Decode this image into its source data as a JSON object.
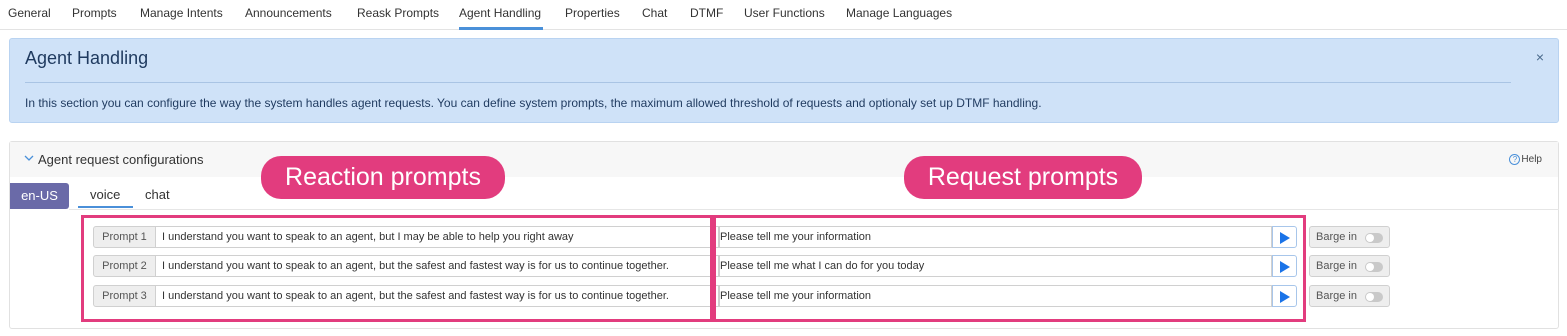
{
  "top_tabs": [
    {
      "label": "General"
    },
    {
      "label": "Prompts"
    },
    {
      "label": "Manage Intents"
    },
    {
      "label": "Announcements"
    },
    {
      "label": "Reask Prompts"
    },
    {
      "label": "Agent Handling",
      "active": true
    },
    {
      "label": "Properties"
    },
    {
      "label": "Chat"
    },
    {
      "label": "DTMF"
    },
    {
      "label": "User Functions"
    },
    {
      "label": "Manage Languages"
    }
  ],
  "banner": {
    "title": "Agent Handling",
    "close_icon": "×",
    "text": "In this section you can configure the way the system handles agent requests. You can define system prompts, the maximum allowed threshold of requests and optionaly set up DTMF handling."
  },
  "panel": {
    "title": "Agent request configurations",
    "help_label": "Help",
    "help_icon": "?",
    "language": "en-US",
    "sub_tabs": [
      {
        "label": "voice",
        "active": true
      },
      {
        "label": "chat"
      }
    ]
  },
  "prompts": [
    {
      "label": "Prompt 1",
      "reaction": "I understand you want to speak to an agent, but I may be able to help you right away",
      "request": "Please tell me your information",
      "barge_label": "Barge in",
      "barge_on": false
    },
    {
      "label": "Prompt 2",
      "reaction": "I understand you want to speak to an agent, but the safest and fastest way is for us to continue together.",
      "request": "Please tell me what I can do for you today",
      "barge_label": "Barge in",
      "barge_on": false
    },
    {
      "label": "Prompt 3",
      "reaction": "I understand you want to speak to an agent, but the safest and fastest way is for us to continue together.",
      "request": "Please tell me your information",
      "barge_label": "Barge in",
      "barge_on": false
    }
  ],
  "annotations": {
    "reaction_label": "Reaction prompts",
    "request_label": "Request prompts",
    "color": "#e23c7e"
  },
  "colors": {
    "accent": "#4a90d9",
    "banner_bg": "#cfe2f8",
    "language_badge": "#6a6aa8",
    "annotation": "#e23c7e"
  }
}
